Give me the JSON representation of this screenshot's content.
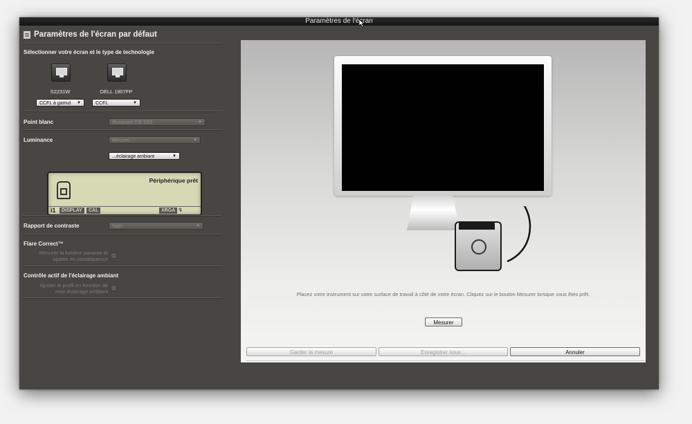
{
  "window": {
    "title": "Paramètres de l'écran"
  },
  "sidebar": {
    "header": "Paramètres de l'écran par défaut",
    "select_label": "Sélectionner votre écran et le type de technologie",
    "monitors": [
      {
        "name": "S2231W",
        "technology": "CCFL à gamut"
      },
      {
        "name": "DELL 1907FP",
        "technology": "CCFL"
      }
    ],
    "white_point": {
      "label": "Point blanc",
      "value": "Illuminant CIE D65"
    },
    "luminance": {
      "label": "Luminance",
      "value": "Mesurer...",
      "ambient": "...éclairage ambiant"
    },
    "lcd": {
      "status": "Périphérique prêt",
      "brand": "i1",
      "display_tag": "DISPLAY",
      "cal_tag": "CAL",
      "xrga_tag": "XRGA"
    },
    "contrast": {
      "label": "Rapport de contraste",
      "value": "Natif"
    },
    "flare": {
      "label": "Flare Correct™",
      "option_line1": "Mesurer la lumière parasite et",
      "option_line2": "ajuster en conséquence"
    },
    "ambient_control": {
      "label": "Contrôle actif de l'éclairage ambiant",
      "option_line1": "Ajuster le profil en fonction de",
      "option_line2": "mon éclairage ambiant"
    }
  },
  "main": {
    "instruction": "Placez votre instrument sur votre surface de travail à côté de votre écran. Cliquez sur le bouton Mesurer lorsque vous êtes prêt.",
    "measure_button": "Mesurer",
    "keep_button": "Garder la mesure",
    "save_button": "Enregistrer sous...",
    "cancel_button": "Annuler"
  },
  "colors": {
    "window_bg": "#474642",
    "panel_bg": "#ededeb",
    "lcd_bg": "#d6d9b4"
  }
}
